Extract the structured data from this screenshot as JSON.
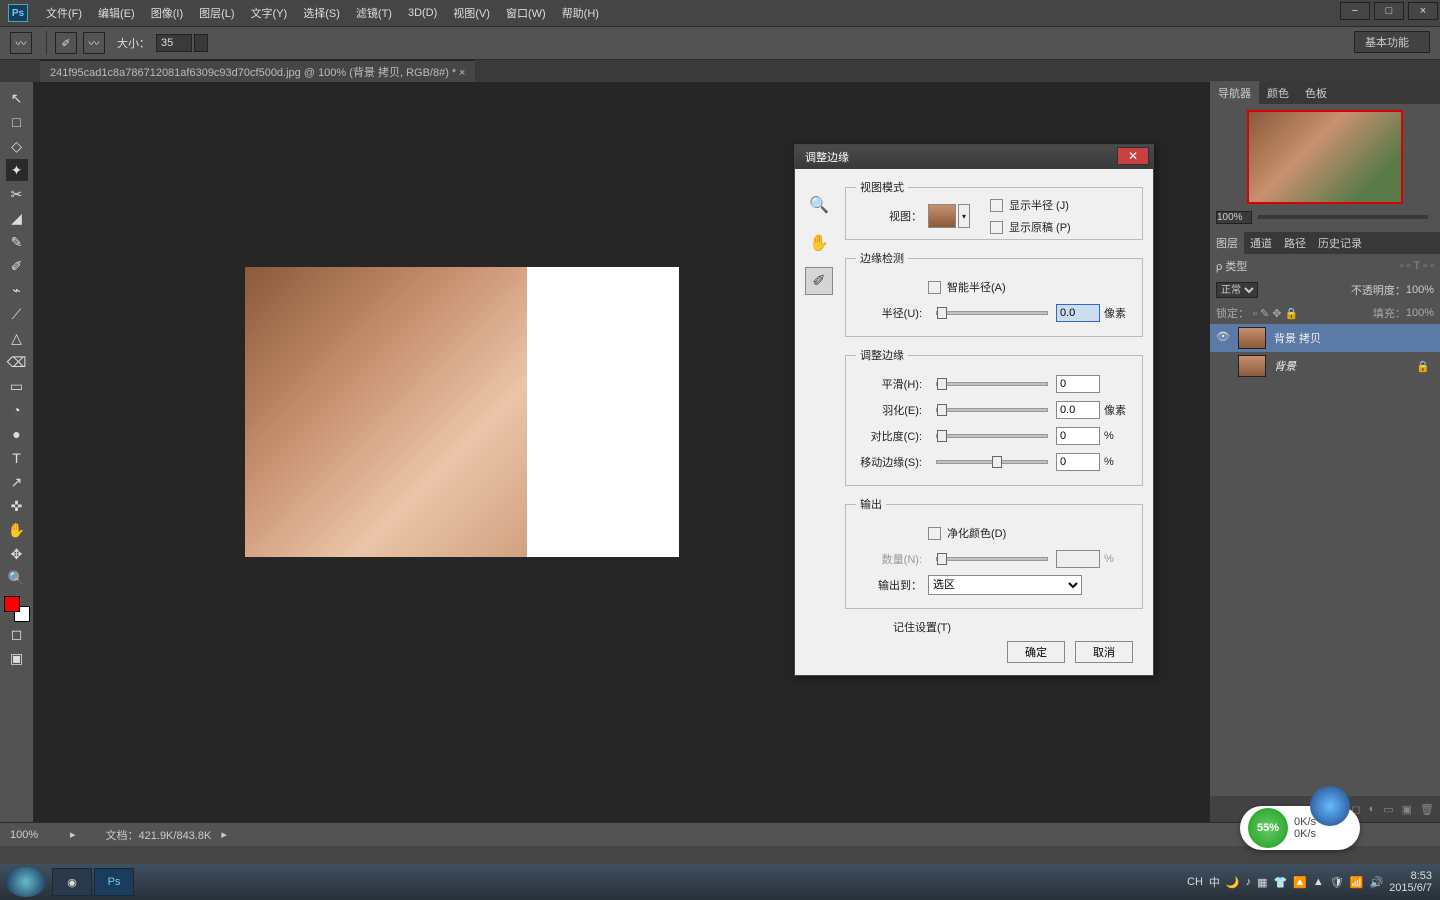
{
  "window_controls": {
    "min": "−",
    "max": "□",
    "close": "×"
  },
  "menubar": {
    "logo": "Ps",
    "items": [
      "文件(F)",
      "编辑(E)",
      "图像(I)",
      "图层(L)",
      "文字(Y)",
      "选择(S)",
      "滤镜(T)",
      "3D(D)",
      "视图(V)",
      "窗口(W)",
      "帮助(H)"
    ]
  },
  "options_bar": {
    "size_label": "大小：",
    "size_value": "35",
    "workspace": "基本功能"
  },
  "doc_tab": "241f95cad1c8a786712081af6309c93d70cf500d.jpg @ 100% (背景 拷贝, RGB/8#) *",
  "tools": [
    "↖",
    "□",
    "◇",
    "✦",
    "✂",
    "◢",
    "✎",
    "✐",
    "⌁",
    "⟋",
    "△",
    "⌫",
    "▭",
    "◔",
    "●",
    "✜",
    "T",
    "↗",
    "✋",
    "✥",
    "🔍"
  ],
  "status": {
    "zoom": "100%",
    "doc": "文档：421.9K/843.8K"
  },
  "right": {
    "nav_tabs": [
      "导航器",
      "颜色",
      "色板"
    ],
    "nav_zoom": "100%",
    "layer_tabs": [
      "图层",
      "通道",
      "路径",
      "历史记录"
    ],
    "filter_label": "ρ 类型",
    "blend": "正常",
    "opacity_label": "不透明度：",
    "opacity": "100%",
    "lock_label": "锁定：",
    "fill_label": "填充：",
    "fill": "100%",
    "layers": [
      "背景 拷贝",
      "背景"
    ]
  },
  "dialog": {
    "title": "调整边缘",
    "group_view": "视图模式",
    "view_label": "视图：",
    "show_radius": "显示半径 (J)",
    "show_orig": "显示原稿 (P)",
    "group_edge": "边缘检测",
    "smart_radius": "智能半径(A)",
    "radius_label": "半径(U):",
    "radius_val": "0.0",
    "px": "像素",
    "group_refine": "调整边缘",
    "smooth": "平滑(H):",
    "smooth_val": "0",
    "feather": "羽化(E):",
    "feather_val": "0.0",
    "contrast": "对比度(C):",
    "contrast_val": "0",
    "shift": "移动边缘(S):",
    "shift_val": "0",
    "pct": "%",
    "group_output": "输出",
    "decon": "净化颜色(D)",
    "amount": "数量(N):",
    "amount_val": "",
    "output_to": "输出到：",
    "output_sel": "选区",
    "remember": "记住设置(T)",
    "ok": "确定",
    "cancel": "取消"
  },
  "taskbar": {
    "ime": "CH",
    "net_up": "0K/s",
    "net_dn": "0K/s",
    "pct": "55%",
    "time": "8:53",
    "date": "2015/6/7"
  }
}
